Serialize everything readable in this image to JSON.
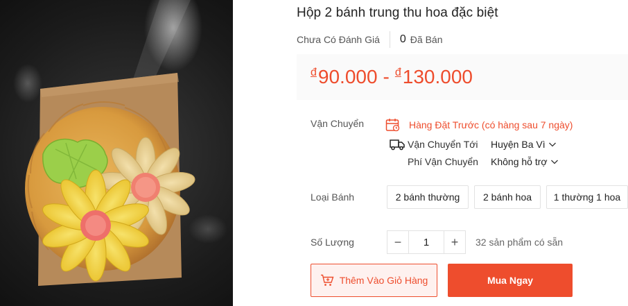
{
  "product": {
    "title": "Hộp 2 bánh trung thu hoa đặc biệt",
    "image_alt_icon": "mooncake-photo",
    "rating_text": "Chưa Có Đánh Giá",
    "sold_count": "0",
    "sold_label": "Đã Bán"
  },
  "price": {
    "currency": "đ",
    "min": "90.000",
    "dash": "-",
    "max": "130.000",
    "color": "#ee4d2d"
  },
  "shipping": {
    "label": "Vận Chuyển",
    "preorder_text": "Hàng Đặt Trước (có hàng sau 7 ngày)",
    "ship_to_label": "Vận Chuyển Tới",
    "ship_to_value": "Huyện Ba Vì",
    "fee_label": "Phí Vận Chuyển",
    "fee_value": "Không hỗ trợ"
  },
  "variants": {
    "label": "Loại Bánh",
    "options": [
      "2 bánh thường",
      "2 bánh hoa",
      "1 thường 1 hoa"
    ]
  },
  "quantity": {
    "label": "Số Lượng",
    "minus": "−",
    "value": "1",
    "plus": "+",
    "stock_text": "32 sản phẩm có sẵn"
  },
  "actions": {
    "add_to_cart": "Thêm Vào Giỏ Hàng",
    "buy_now": "Mua Ngay"
  },
  "colors": {
    "accent": "#ee4d2d",
    "price_bg": "#fafafa"
  }
}
